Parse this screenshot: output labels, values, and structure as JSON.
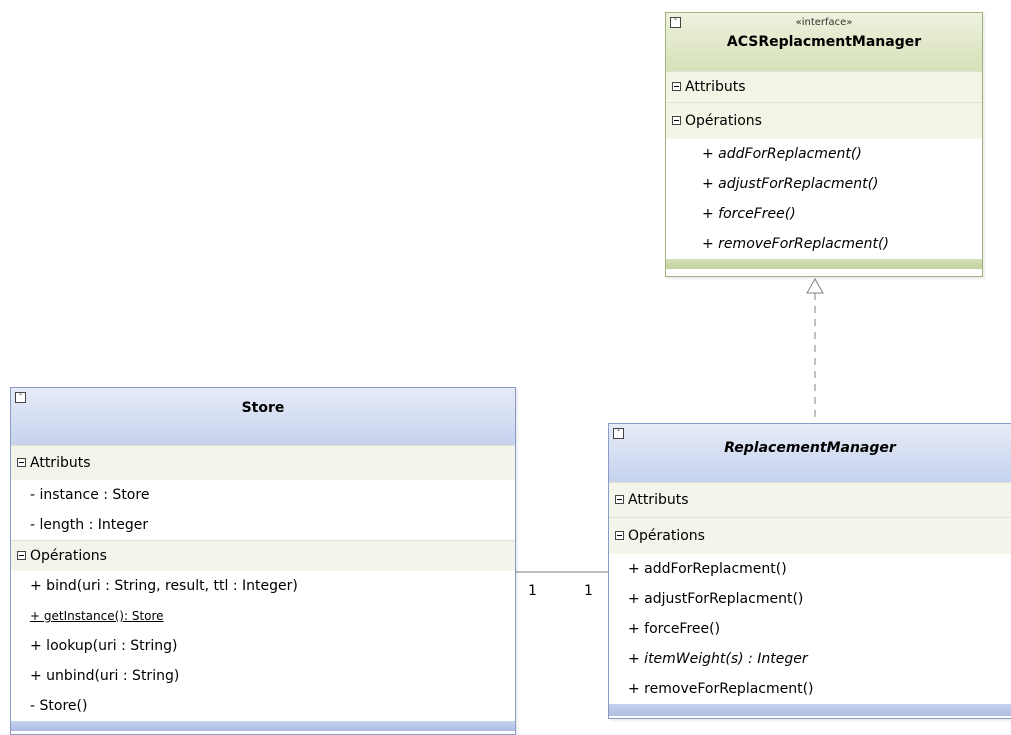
{
  "interface_class": {
    "stereotype": "«interface»",
    "name": "ACSReplacmentManager",
    "attributes_label": "Attributs",
    "operations_label": "Opérations",
    "operations": [
      "+ addForReplacment()",
      "+ adjustForReplacment()",
      "+ forceFree()",
      "+ removeForReplacment()"
    ]
  },
  "store_class": {
    "name": "Store",
    "attributes_label": "Attributs",
    "attributes": [
      "- instance : Store",
      "- length : Integer"
    ],
    "operations_label": "Opérations",
    "operations": [
      "+ bind(uri : String, result, ttl : Integer)",
      "+ getInstance(): Store",
      "+ lookup(uri : String)",
      "+ unbind(uri : String)",
      "- Store()"
    ]
  },
  "replacement_class": {
    "name": "ReplacementManager",
    "attributes_label": "Attributs",
    "operations_label": "Opérations",
    "operations": [
      "+ addForReplacment()",
      "+ adjustForReplacment()",
      "+ forceFree()",
      "+ itemWeight(s) : Integer",
      "+ removeForReplacment()"
    ]
  },
  "association": {
    "store_multiplicity": "1",
    "replacement_multiplicity": "1"
  }
}
